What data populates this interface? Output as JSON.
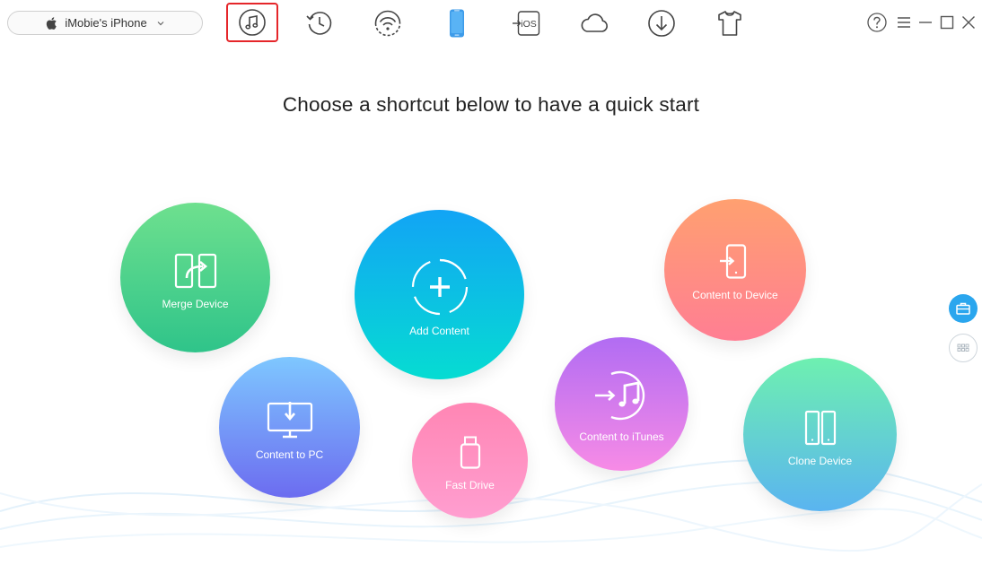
{
  "device": {
    "name": "iMobie's iPhone"
  },
  "toolbar": {
    "items": [
      {
        "icon": "music-note-icon"
      },
      {
        "icon": "history-clock-icon"
      },
      {
        "icon": "wifi-icon"
      },
      {
        "icon": "phone-icon"
      },
      {
        "icon": "ios-import-icon"
      },
      {
        "icon": "cloud-icon"
      },
      {
        "icon": "download-icon"
      },
      {
        "icon": "tshirt-icon"
      }
    ],
    "ios_text": "iOS",
    "selected_outline_color": "#e5262a"
  },
  "window": {
    "controls": [
      "help-icon",
      "menu-icon",
      "minimize-icon",
      "maximize-icon",
      "close-icon"
    ]
  },
  "main": {
    "headline": "Choose a shortcut below to have a quick start"
  },
  "shortcuts": {
    "merge_device": "Merge Device",
    "add_content": "Add Content",
    "content_to_device": "Content to Device",
    "content_to_pc": "Content to PC",
    "fast_drive": "Fast Drive",
    "content_to_itunes": "Content to iTunes",
    "clone_device": "Clone Device"
  },
  "colors": {
    "merge_device": [
      "#6ee08e",
      "#2fc48a"
    ],
    "add_content": [
      "#12a4f5",
      "#06dcd2"
    ],
    "content_to_device": [
      "#ffa070",
      "#ff7e93"
    ],
    "content_to_pc": [
      "#7ec7ff",
      "#6c6cf0"
    ],
    "fast_drive": [
      "#ff86b4",
      "#ff9ed0"
    ],
    "content_to_itunes": [
      "#b16cf3",
      "#f78be6"
    ],
    "clone_device": [
      "#6ef0b0",
      "#5ab4f0"
    ],
    "side_active": "#2aa6ee"
  }
}
